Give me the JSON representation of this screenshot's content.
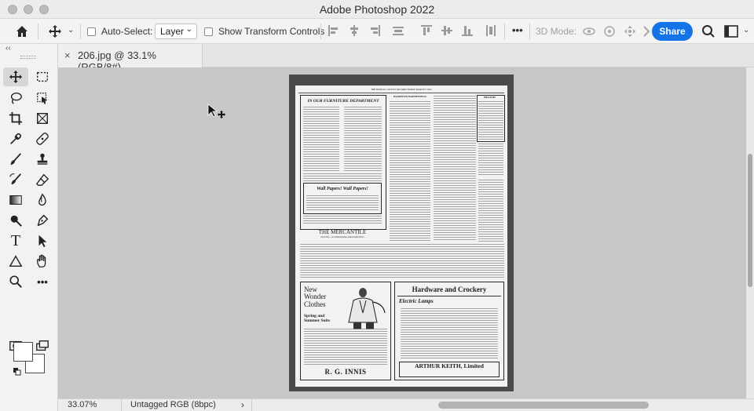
{
  "app": {
    "title": "Adobe Photoshop 2022"
  },
  "options_bar": {
    "auto_select_label": "Auto-Select:",
    "auto_select_value": "Layer",
    "show_transform_label": "Show Transform Controls",
    "mode_3d_label": "3D Mode:",
    "more_label": "•••",
    "share_label": "Share"
  },
  "document": {
    "tab_label": "206.jpg @ 33.1% (RGB/8#)",
    "close_glyph": "×"
  },
  "status_bar": {
    "zoom": "33.07%",
    "profile": "Untagged RGB (8bpc)",
    "arrow": "›"
  },
  "toolbar": {
    "collapse_glyph": "‹‹",
    "more_tools": "•••",
    "type_tool": "T"
  },
  "newspaper": {
    "masthead": "THE BUREAU COUNTY RECORD  FRIDAY MARCH 3 1922",
    "furniture_heading": "IN OUR FURNITURE DEPARTMENT",
    "wallpaper_heading": "Wall Papers!   Wall Papers!",
    "mercantile_heading": "THE MERCANTILE",
    "mercantile_sub": "Our Policy - Good Merchandise at Reasonable Prices",
    "clothes_heading": "New Wonder Clothes",
    "suits_heading": "Spring and Summer Suits",
    "innis_name": "R. G. INNIS",
    "hardware_heading": "Hardware and Crockery",
    "lamps_heading": "Electric Lamps",
    "keith_name": "ARTHUR KEITH, Limited"
  }
}
